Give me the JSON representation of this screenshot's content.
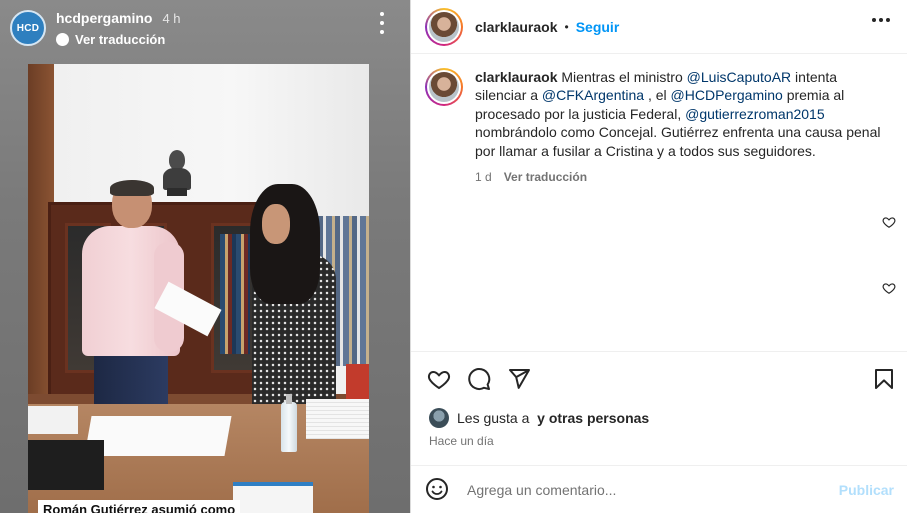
{
  "story": {
    "account_initials": "HCD",
    "username": "hcdpergamino",
    "time": "4 h",
    "translate_label": "Ver traducción",
    "caption": "Román Gutiérrez asumió como"
  },
  "post": {
    "header": {
      "username": "clarklauraok",
      "separator": "•",
      "follow_label": "Seguir"
    },
    "caption": {
      "username": "clarklauraok",
      "text_1": "Mientras el ministro",
      "mention_1": "@LuisCaputoAR",
      "text_2": "intenta silenciar a",
      "mention_2": "@CFKArgentina",
      "text_3": ", el",
      "mention_3": "@HCDPergamino",
      "text_4": "premia al procesado por la justicia Federal,",
      "mention_4": "@gutierrezroman2015",
      "text_5": "nombrándolo como Concejal. Gutiérrez enfrenta una causa penal por llamar a fusilar a Cristina y a todos sus seguidores.",
      "age": "1 d",
      "translate_label": "Ver traducción"
    },
    "likes": {
      "prefix": "Les gusta a",
      "suffix": "y otras personas"
    },
    "time_ago": "Hace un día",
    "composer": {
      "placeholder": "Agrega un comentario...",
      "publish_label": "Publicar"
    }
  },
  "colors": {
    "link_blue": "#0095f6",
    "mention_navy": "#00376b",
    "publish_disabled": "#b2dffc"
  }
}
